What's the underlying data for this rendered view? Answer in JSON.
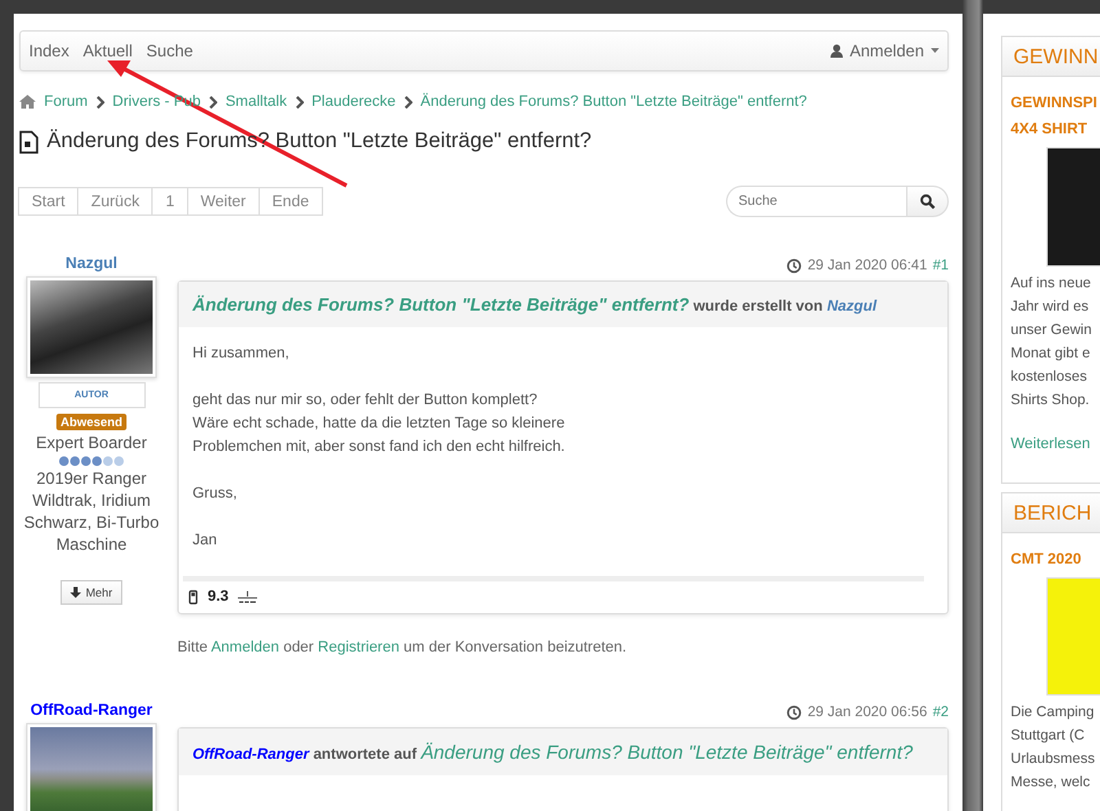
{
  "nav": {
    "items": [
      {
        "label": "Index"
      },
      {
        "label": "Aktuell"
      },
      {
        "label": "Suche"
      }
    ],
    "login": "Anmelden"
  },
  "breadcrumb": [
    "Forum",
    "Drivers - Pub",
    "Smalltalk",
    "Plauderecke",
    "Änderung des Forums? Button \"Letzte Beiträge\" entfernt?"
  ],
  "title": "Änderung des Forums? Button \"Letzte Beiträge\" entfernt?",
  "pagination": [
    "Start",
    "Zurück",
    "1",
    "Weiter",
    "Ende"
  ],
  "search": {
    "placeholder": "Suche"
  },
  "posts": [
    {
      "author": "Nazgul",
      "color": "#4a7fb5",
      "role": "AUTOR",
      "status": "Abwesend",
      "rank": "Expert Boarder",
      "stars": 4,
      "signature": "2019er Ranger Wildtrak, Iridium Schwarz, Bi-Turbo Maschine",
      "more": "Mehr",
      "date": "29 Jan 2020 06:41",
      "number": "#1",
      "header": {
        "kind": "created",
        "title": "Änderung des Forums? Button \"Letzte Beiträge\" entfernt?",
        "verb": "wurde erstellt von",
        "author": "Nazgul"
      },
      "body": [
        "Hi zusammen,",
        "geht das nur mir so, oder fehlt der Button komplett?\nWäre echt schade, hatte da die letzten Tage so kleinere\nProblemchen mit, aber sonst fand ich den echt hilfreich.",
        "Gruss,",
        "Jan"
      ],
      "consumption": "9.3"
    },
    {
      "author": "OffRoad-Ranger",
      "color": "#0000ff",
      "date": "29 Jan 2020 06:56",
      "number": "#2",
      "header": {
        "kind": "replied",
        "title": "Änderung des Forums? Button \"Letzte Beiträge\" entfernt?",
        "verb": "antwortete auf",
        "author": "OffRoad-Ranger"
      }
    }
  ],
  "login_prompt": [
    {
      "text": "Bitte "
    },
    {
      "link": "Anmelden"
    },
    {
      "text": " oder "
    },
    {
      "link": "Registrieren"
    },
    {
      "text": " um der Konversation beizutreten."
    }
  ],
  "sidebar": [
    {
      "heading": "GEWINN",
      "subtitle": "GEWINNSPI\n4X4 SHIRT",
      "text": "Auf ins neue\nJahr wird es\nunser Gewin\nMonat gibt e\nkostenloses\nShirts Shop.",
      "link": "Weiterlesen"
    },
    {
      "heading": "BERICH",
      "subtitle": "CMT 2020",
      "text": "Die Camping\nStuttgart (C\nUrlaubsmess\nMesse, welc"
    }
  ]
}
